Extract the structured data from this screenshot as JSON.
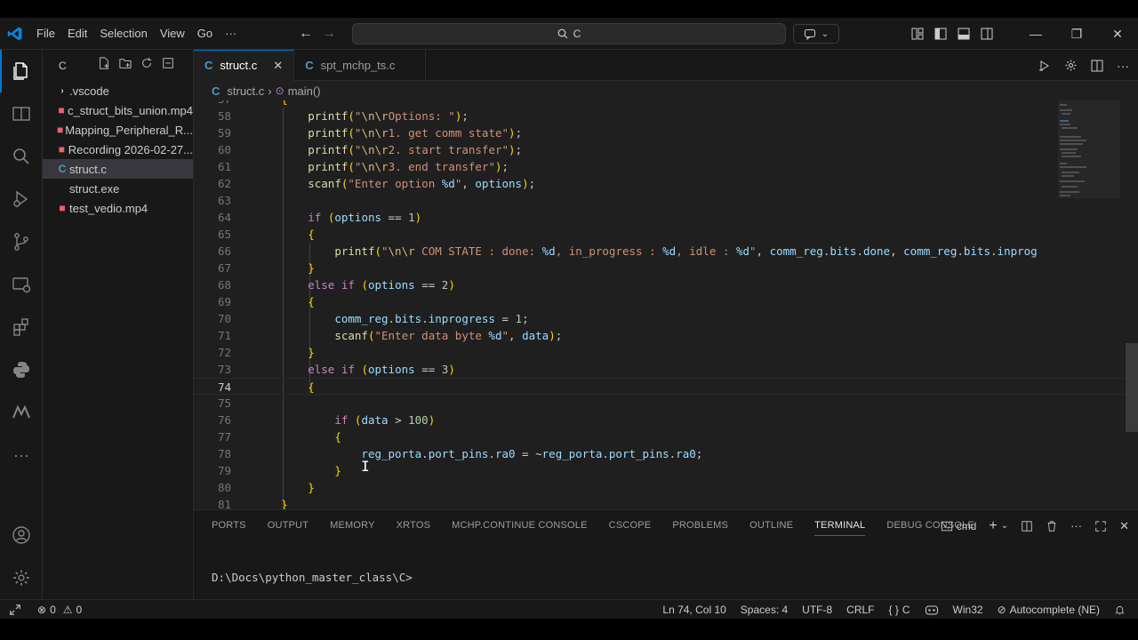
{
  "menu": {
    "items": [
      "File",
      "Edit",
      "Selection",
      "View",
      "Go",
      "···"
    ]
  },
  "command_center": {
    "text": "C"
  },
  "sidebar": {
    "title": "C",
    "items": [
      {
        "label": ".vscode",
        "type": "folder"
      },
      {
        "label": "c_struct_bits_union.mp4",
        "type": "mp4"
      },
      {
        "label": "Mapping_Peripheral_R...",
        "type": "mp4"
      },
      {
        "label": "Recording 2026-02-27...",
        "type": "mp4"
      },
      {
        "label": "struct.c",
        "type": "c",
        "selected": true
      },
      {
        "label": "struct.exe",
        "type": "exe"
      },
      {
        "label": "test_vedio.mp4",
        "type": "mp4"
      }
    ]
  },
  "tabs": [
    {
      "label": "struct.c",
      "active": true,
      "close": "✕"
    },
    {
      "label": "spt_mchp_ts.c",
      "active": false
    }
  ],
  "breadcrumb": {
    "file": "struct.c",
    "symbol": "main()"
  },
  "code": {
    "current_line": 74,
    "lines": [
      {
        "n": "57",
        "text": "    {"
      },
      {
        "n": "58",
        "text": "        printf(\"\\n\\rOptions: \");"
      },
      {
        "n": "59",
        "text": "        printf(\"\\n\\r1. get comm state\");"
      },
      {
        "n": "60",
        "text": "        printf(\"\\n\\r2. start transfer\");"
      },
      {
        "n": "61",
        "text": "        printf(\"\\n\\r3. end transfer\");"
      },
      {
        "n": "62",
        "text": "        scanf(\"Enter option %d\", options);"
      },
      {
        "n": "63",
        "text": ""
      },
      {
        "n": "64",
        "text": "        if (options == 1)"
      },
      {
        "n": "65",
        "text": "        {"
      },
      {
        "n": "66",
        "text": "            printf(\"\\n\\r COM STATE : done: %d, in_progress : %d, idle : %d\", comm_reg.bits.done, comm_reg.bits.inprog"
      },
      {
        "n": "67",
        "text": "        }"
      },
      {
        "n": "68",
        "text": "        else if (options == 2)"
      },
      {
        "n": "69",
        "text": "        {"
      },
      {
        "n": "70",
        "text": "            comm_reg.bits.inprogress = 1;"
      },
      {
        "n": "71",
        "text": "            scanf(\"Enter data byte %d\", data);"
      },
      {
        "n": "72",
        "text": "        }"
      },
      {
        "n": "73",
        "text": "        else if (options == 3)"
      },
      {
        "n": "74",
        "text": "        {"
      },
      {
        "n": "75",
        "text": ""
      },
      {
        "n": "76",
        "text": "            if (data > 100)"
      },
      {
        "n": "77",
        "text": "            {"
      },
      {
        "n": "78",
        "text": "                reg_porta.port_pins.ra0 = ~reg_porta.port_pins.ra0;"
      },
      {
        "n": "79",
        "text": "            }"
      },
      {
        "n": "80",
        "text": "        }"
      },
      {
        "n": "81",
        "text": "    }"
      }
    ]
  },
  "panel": {
    "tabs": [
      "PORTS",
      "OUTPUT",
      "MEMORY",
      "XRTOS",
      "MCHP.CONTINUE CONSOLE",
      "CSCOPE",
      "PROBLEMS",
      "OUTLINE",
      "TERMINAL",
      "DEBUG CONSOLE"
    ],
    "active_tab": "TERMINAL",
    "shell": "cmd",
    "prompt": "D:\\Docs\\python_master_class\\C>"
  },
  "status": {
    "errors": "0",
    "warnings": "0",
    "position": "Ln 74, Col 10",
    "spaces": "Spaces: 4",
    "encoding": "UTF-8",
    "eol": "CRLF",
    "language": "C",
    "platform": "Win32",
    "autocomplete": "Autocomplete (NE)"
  },
  "colors": {
    "accent": "#0078d4",
    "background": "#1f1f1f",
    "sidebar": "#181818",
    "c_icon": "#519aba",
    "mp4_icon": "#f0616a"
  }
}
